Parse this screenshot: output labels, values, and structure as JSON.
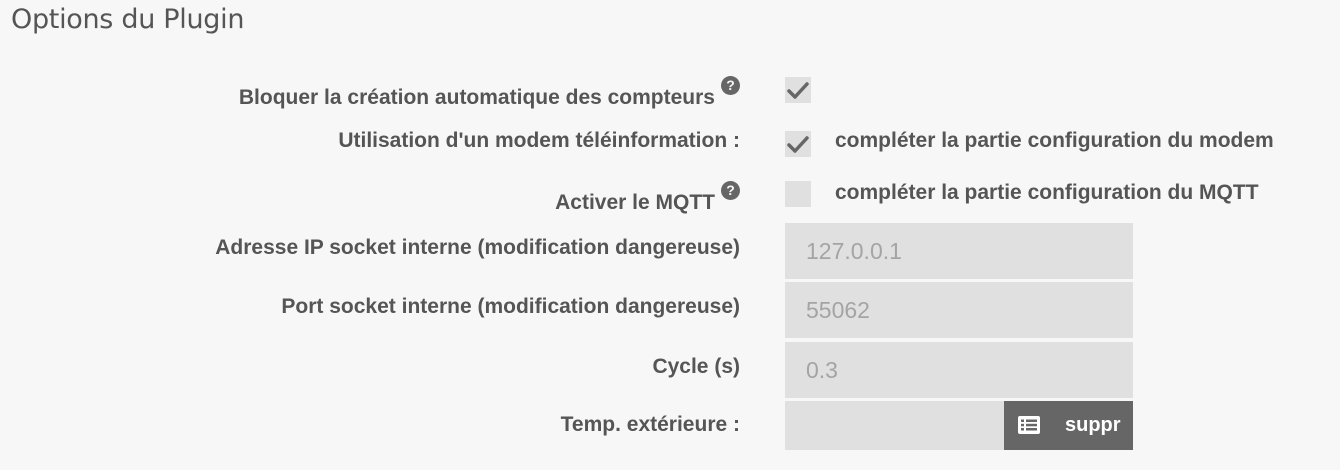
{
  "section": {
    "title": "Options du Plugin"
  },
  "options": {
    "block_counters": {
      "label": "Bloquer la création automatique des compteurs",
      "help_icon": "?",
      "checked": true
    },
    "modem": {
      "label": "Utilisation d'un modem téléinformation :",
      "checked": true,
      "hint": "compléter la partie configuration du modem"
    },
    "mqtt": {
      "label": "Activer le MQTT",
      "help_icon": "?",
      "checked": false,
      "hint": "compléter la partie configuration du MQTT"
    },
    "socket_ip": {
      "label": "Adresse IP socket interne (modification dangereuse)",
      "value": "127.0.0.1"
    },
    "socket_port": {
      "label": "Port socket interne (modification dangereuse)",
      "value": "55062"
    },
    "cycle": {
      "label": "Cycle (s)",
      "value": "0.3"
    },
    "temp_ext": {
      "label": "Temp. extérieure :",
      "value": "",
      "button_label": "suppr",
      "button_icon": "list-icon"
    }
  },
  "colors": {
    "background": "#f7f7f7",
    "text": "#555555",
    "field_bg": "#e0e0e0",
    "button_bg": "#666666",
    "value_text": "#a4a4a4"
  }
}
